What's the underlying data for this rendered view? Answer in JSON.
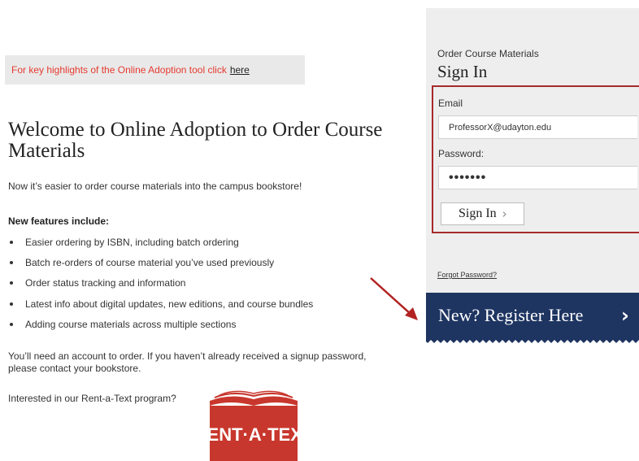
{
  "highlight": {
    "text": "For key highlights of the Online Adoption tool click",
    "link": "here"
  },
  "welcome": {
    "title": "Welcome to Online Adoption to Order Course Materials",
    "intro": "Now it’s easier to order course materials into the campus bookstore!"
  },
  "features": {
    "title": "New features include:",
    "items": [
      "Easier ordering by ISBN, including batch ordering",
      "Batch re-orders of course material you’ve used previously",
      "Order status tracking and information",
      "Latest info about digital updates, new editions, and course bundles",
      "Adding course materials across multiple sections"
    ]
  },
  "account_note": "You’ll need an account to order. If you haven’t already received a signup password, please contact your bookstore.",
  "rent": {
    "note": "Interested in our Rent-a-Text program?",
    "logo_text": "RENT·A·TEXT"
  },
  "signin": {
    "subtitle": "Order Course Materials",
    "title": "Sign In",
    "email_label": "Email",
    "email_value": "ProfessorX@udayton.edu",
    "password_label": "Password:",
    "password_value": "•••••••",
    "button_label": "Sign In",
    "forgot_label": "Forgot Password?"
  },
  "register": {
    "label": "New? Register Here"
  },
  "colors": {
    "highlight_text": "#e53a2f",
    "panel_bg": "#eeeeee",
    "signin_border": "#a52a2a",
    "register_bg": "#1e3461",
    "logo_red": "#c8372d",
    "arrow_red": "#b22222"
  },
  "icons": {
    "signin_chevron": "chevron-right-icon",
    "register_chevron": "chevron-right-icon",
    "annotation_arrow": "arrow-icon"
  }
}
